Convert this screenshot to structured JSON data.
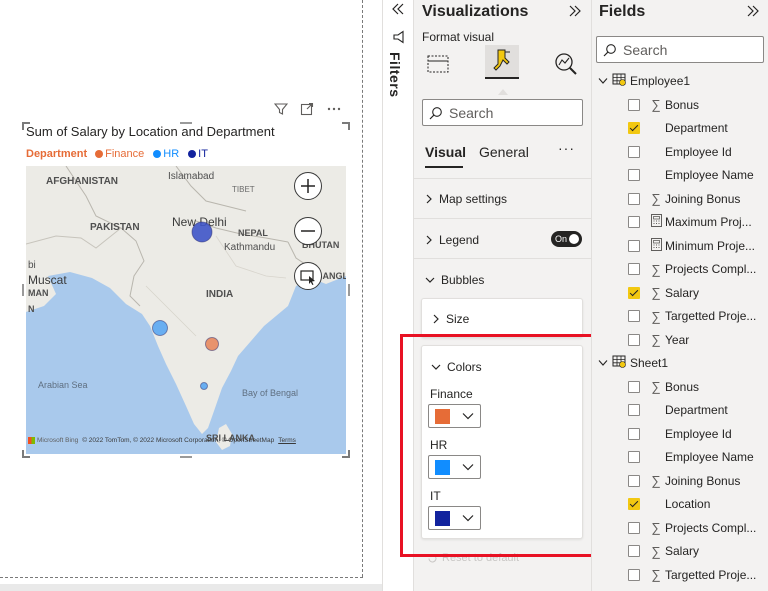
{
  "visual": {
    "title": "Sum of Salary by Location and Department",
    "legend_title": "Department",
    "legend": [
      {
        "label": "Finance",
        "color": "#e66c37"
      },
      {
        "label": "HR",
        "color": "#118dff"
      },
      {
        "label": "IT",
        "color": "#12239e"
      }
    ],
    "map_labels": {
      "afghanistan": "AFGHANISTAN",
      "islamabad": "Islamabad",
      "tibet": "TIBET",
      "pakistan": "PAKISTAN",
      "new_delhi": "New Delhi",
      "kathmandu": "Kathmandu",
      "nepal": "NEPAL",
      "bhutan": "BHUTAN",
      "bi": "bi",
      "muscat": "Muscat",
      "oman": "MAN",
      "india": "INDIA",
      "bangladesh": "BANGLADES",
      "n_frag": "N",
      "arabian_sea": "Arabian Sea",
      "bay_of_bengal": "Bay of Bengal",
      "sri_lanka": "SRI LANKA"
    },
    "attribution": {
      "brand": "Microsoft Bing",
      "copyright": "© 2022 TomTom, © 2022 Microsoft Corporation, © OpenStreetMap",
      "terms": "Terms"
    }
  },
  "map_bubbles": [
    {
      "location": "New Delhi",
      "department": "IT",
      "color": "#3f55c8"
    },
    {
      "location": "Mumbai",
      "department": "HR",
      "color": "#5ba7f2"
    },
    {
      "location": "Hyderabad",
      "department": "Finance",
      "color": "#e8895f"
    },
    {
      "location": "Bengaluru",
      "department": "HR",
      "color": "#5ba7f2"
    }
  ],
  "filters_label": "Filters",
  "viz_pane": {
    "title": "Visualizations",
    "format_visual": "Format visual",
    "search_placeholder": "Search",
    "tabs": {
      "visual": "Visual",
      "general": "General",
      "more": "···"
    },
    "sections": {
      "map_settings": "Map settings",
      "legend": "Legend",
      "legend_toggle": "On",
      "bubbles": "Bubbles",
      "size": "Size",
      "colors": "Colors"
    },
    "colors": [
      {
        "label": "Finance",
        "color": "#e66c37"
      },
      {
        "label": "HR",
        "color": "#118dff"
      },
      {
        "label": "IT",
        "color": "#12239e"
      }
    ],
    "reset": "Reset to default"
  },
  "fields_pane": {
    "title": "Fields",
    "search_placeholder": "Search",
    "tables": [
      {
        "name": "Employee1",
        "fields": [
          {
            "name": "Bonus",
            "sigma": true,
            "checked": false
          },
          {
            "name": "Department",
            "sigma": false,
            "checked": true
          },
          {
            "name": "Employee Id",
            "sigma": false,
            "checked": false
          },
          {
            "name": "Employee Name",
            "sigma": false,
            "checked": false
          },
          {
            "name": "Joining Bonus",
            "sigma": true,
            "checked": false
          },
          {
            "name": "Maximum Proj...",
            "calc": true,
            "checked": false
          },
          {
            "name": "Minimum Proje...",
            "calc": true,
            "checked": false
          },
          {
            "name": "Projects Compl...",
            "sigma": true,
            "checked": false
          },
          {
            "name": "Salary",
            "sigma": true,
            "checked": true
          },
          {
            "name": "Targetted Proje...",
            "sigma": true,
            "checked": false
          },
          {
            "name": "Year",
            "sigma": true,
            "checked": false
          }
        ]
      },
      {
        "name": "Sheet1",
        "fields": [
          {
            "name": "Bonus",
            "sigma": true,
            "checked": false
          },
          {
            "name": "Department",
            "sigma": false,
            "checked": false
          },
          {
            "name": "Employee Id",
            "sigma": false,
            "checked": false
          },
          {
            "name": "Employee Name",
            "sigma": false,
            "checked": false
          },
          {
            "name": "Joining Bonus",
            "sigma": true,
            "checked": false
          },
          {
            "name": "Location",
            "sigma": false,
            "checked": true
          },
          {
            "name": "Projects Compl...",
            "sigma": true,
            "checked": false
          },
          {
            "name": "Salary",
            "sigma": true,
            "checked": false
          },
          {
            "name": "Targetted Proje...",
            "sigma": true,
            "checked": false
          }
        ]
      }
    ]
  }
}
